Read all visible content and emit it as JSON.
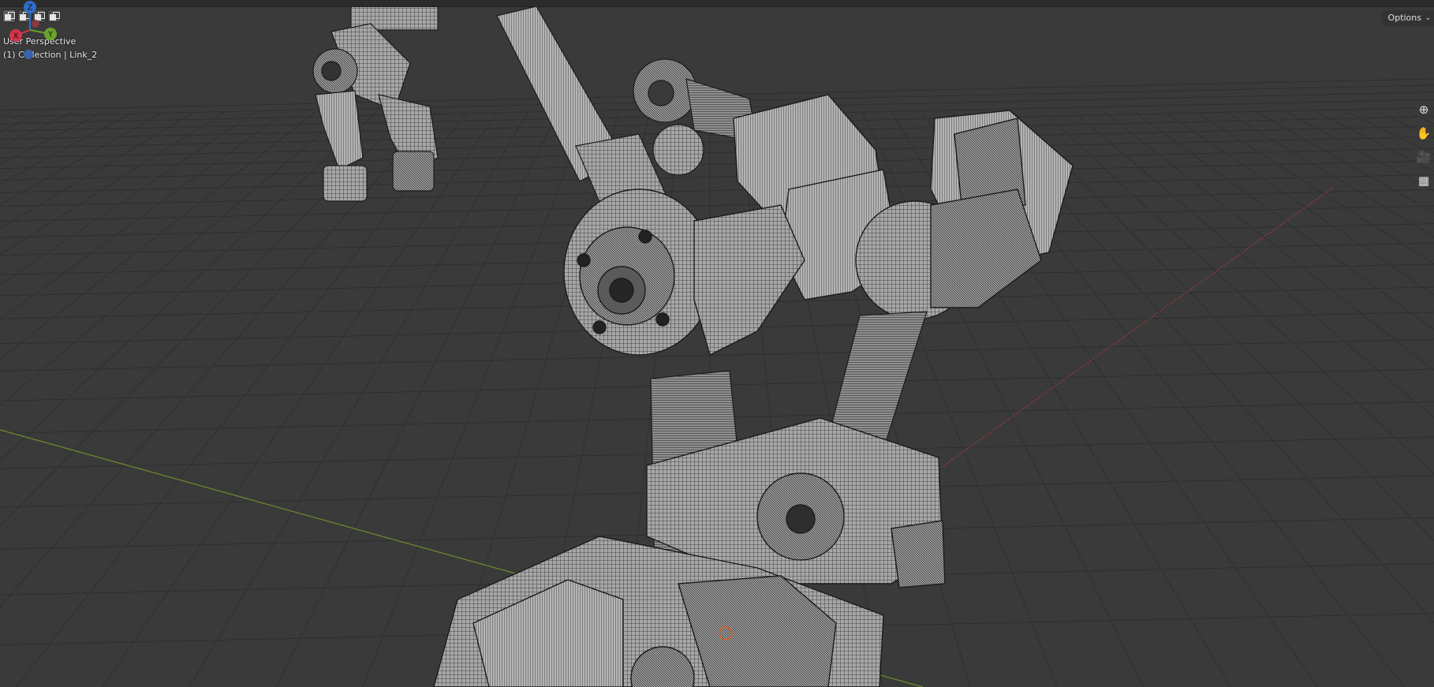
{
  "viewport": {
    "view_name": "User Perspective",
    "collection_line": "(1) Collection | Link_2"
  },
  "header": {
    "options_label": "Options",
    "options_chevron": "⌄"
  },
  "gizmo": {
    "axes": {
      "z": {
        "label": "Z",
        "color": "#2f6fcc"
      },
      "y": {
        "label": "Y",
        "color": "#6aa32a"
      },
      "x": {
        "label": "X",
        "color": "#d2344a"
      }
    }
  },
  "nav_tools": [
    {
      "name": "zoom-icon",
      "glyph": "⊕"
    },
    {
      "name": "pan-hand-icon",
      "glyph": "✋"
    },
    {
      "name": "camera-icon",
      "glyph": "🎥"
    },
    {
      "name": "perspective-grid-icon",
      "glyph": "▦"
    }
  ],
  "colors": {
    "background": "#3a3a3a",
    "grid_line": "#2e2e2e",
    "x_axis_line": "#a4373a",
    "y_axis_line": "#6d8f2c",
    "mesh_fill": "#a9a9a9",
    "wire": "#1c1c1c"
  }
}
